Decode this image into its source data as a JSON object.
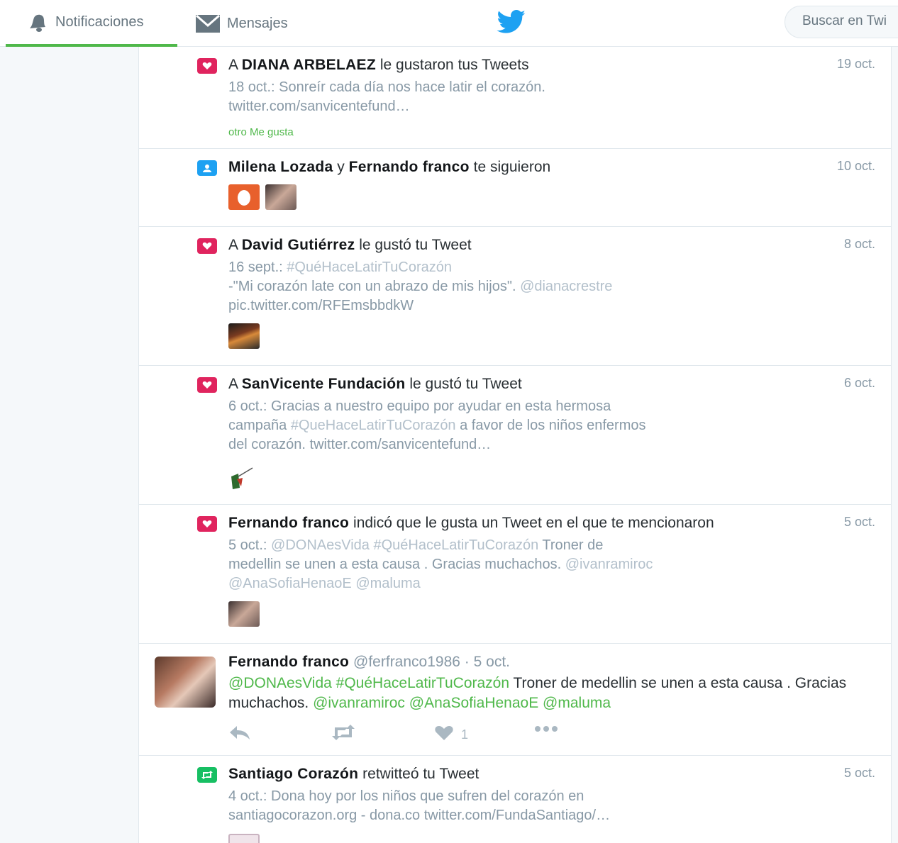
{
  "nav": {
    "notifications_label": "Notificaciones",
    "messages_label": "Mensajes",
    "search_placeholder": "Buscar en Twi",
    "accent": "#4fb84a",
    "bird_color": "#1da1f2"
  },
  "notifications": [
    {
      "type": "like",
      "pre": "A ",
      "name1": "DIANA ARBELAEZ",
      "post": " le gustaron tus Tweets",
      "time": "19 oct.",
      "line1": "18 oct.: Sonreír cada día nos hace latir el corazón.",
      "line2": "twitter.com/sanvicentefund…",
      "extra": "otro Me gusta"
    },
    {
      "type": "follow",
      "name1": "Milena Lozada",
      "mid": " y ",
      "name2": "Fernando franco",
      "post": " te siguieron",
      "time": "10 oct."
    },
    {
      "type": "like",
      "pre": "A ",
      "name1": "David Gutiérrez",
      "post": " le gustó tu Tweet",
      "time": "8 oct.",
      "line1_a": "16 sept.: ",
      "line1_b": "#QuéHaceLatirTuCorazón",
      "line2_a": "-\"Mi corazón late con un abrazo de mis hijos\". ",
      "line2_b": "@dianacrestre",
      "line3": "pic.twitter.com/RFEmsbbdkW"
    },
    {
      "type": "like",
      "pre": "A ",
      "name1": "SanVicente Fundación",
      "post": " le gustó tu Tweet",
      "time": "6 oct.",
      "line1": "6 oct.: Gracias a nuestro equipo por ayudar en esta hermosa",
      "line2_a": "campaña ",
      "line2_b": "#QueHaceLatirTuCorazón",
      "line2_c": " a favor de los niños enfermos",
      "line3": "del corazón. twitter.com/sanvicentefund…"
    },
    {
      "type": "like",
      "name1": "Fernando franco",
      "post": " indicó que le gusta un Tweet en el que te mencionaron",
      "time": "5 oct.",
      "line1_a": "5 oct.: ",
      "line1_b": "@DONAesVida",
      "line1_c": "  ",
      "line1_d": "#QuéHaceLatirTuCorazón",
      "line1_e": " Troner de",
      "line2_a": "medellin se unen a esta causa . Gracias muchachos. ",
      "line2_b": "@ivanramiroc",
      "line3_a": "@AnaSofiaHenaoE",
      "line3_b": " ",
      "line3_c": "@maluma"
    }
  ],
  "tweet": {
    "name": "Fernando franco",
    "handle": "@ferfranco1986",
    "dot": " · ",
    "time": "5 oct.",
    "t1": "@DONAesVida",
    "t2": "  ",
    "t3": "#QuéHaceLatirTuCorazón",
    "t4": " Troner de medellin se unen a esta causa . Gracias muchachos. ",
    "t5": "@ivanramiroc",
    "t6": " ",
    "t7": "@AnaSofiaHenaoE",
    "t8": " ",
    "t9": "@maluma",
    "like_count": "1",
    "link_color": "#4fb84a"
  },
  "retweet": {
    "name1": "Santiago Corazón",
    "post": " retwitteó tu Tweet",
    "time": "5 oct.",
    "line1": "4 oct.: Dona hoy por los niños que sufren del corazón en",
    "line2": "santiagocorazon.org - dona.co twitter.com/FundaSantiago/…"
  }
}
